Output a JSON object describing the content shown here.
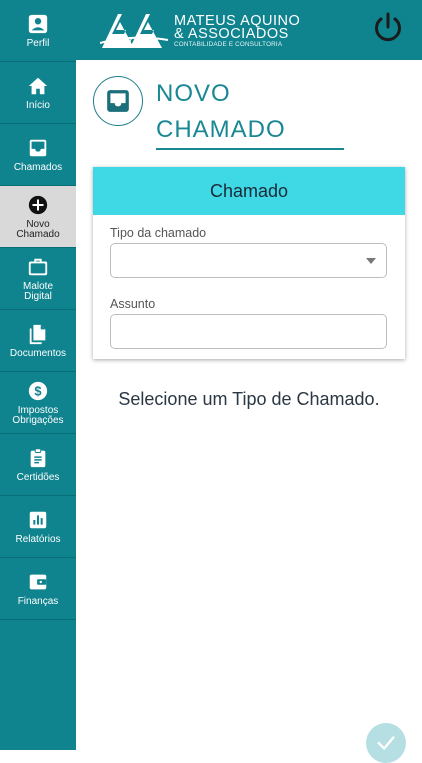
{
  "header": {
    "brand_line1": "MATEUS AQUINO",
    "brand_line2": "& ASSOCIADOS",
    "brand_tagline": "CONTABILIDADE E CONSULTORIA",
    "logo_monogram": "AA",
    "icons": {
      "power": "power-icon"
    }
  },
  "sidebar": {
    "items": [
      {
        "label": "Perfil",
        "icon": "profile-icon"
      },
      {
        "label": "Início",
        "icon": "home-icon"
      },
      {
        "label": "Chamados",
        "icon": "inbox-icon"
      },
      {
        "label": "Novo Chamado",
        "icon": "add-circle-icon",
        "active": true
      },
      {
        "label": "Malote Digital",
        "icon": "briefcase-icon"
      },
      {
        "label": "Documentos",
        "icon": "documents-icon"
      },
      {
        "label": "Impostos Obrigações",
        "icon": "dollar-icon"
      },
      {
        "label": "Certidões",
        "icon": "clipboard-icon"
      },
      {
        "label": "Relatórios",
        "icon": "chart-icon"
      },
      {
        "label": "Finanças",
        "icon": "wallet-icon"
      }
    ]
  },
  "main": {
    "title": "NOVO CHAMADO",
    "card": {
      "header": "Chamado",
      "tipo_label": "Tipo da chamado",
      "tipo_value": "",
      "assunto_label": "Assunto",
      "assunto_value": ""
    },
    "hint": "Selecione um Tipo de Chamado."
  },
  "colors": {
    "primary": "#0f838e",
    "accent": "#3fd9e6",
    "active_item_bg": "#d9d9d9",
    "fab": "#b6dfe3"
  }
}
